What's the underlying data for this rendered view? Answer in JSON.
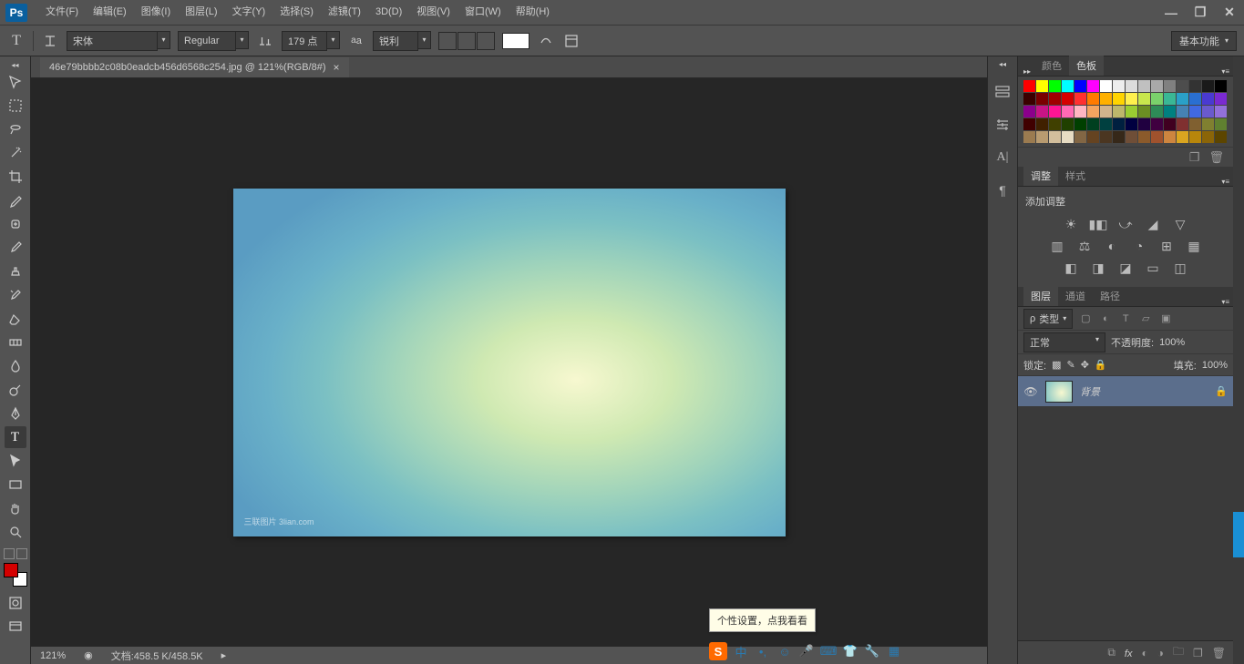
{
  "menubar": {
    "items": [
      "文件(F)",
      "编辑(E)",
      "图像(I)",
      "图层(L)",
      "文字(Y)",
      "选择(S)",
      "滤镜(T)",
      "3D(D)",
      "视图(V)",
      "窗口(W)",
      "帮助(H)"
    ]
  },
  "optbar": {
    "font_family": "宋体",
    "font_style": "Regular",
    "font_size": "179 点",
    "antialias": "锐利",
    "workspace": "基本功能"
  },
  "document": {
    "tab_title": "46e79bbbb2c08b0eadcb456d6568c254.jpg @ 121%(RGB/8#)",
    "watermark": "三联图片  3lian.com"
  },
  "status": {
    "zoom": "121%",
    "doc_size": "文档:458.5 K/458.5K"
  },
  "panels": {
    "color_tabs": [
      "颜色",
      "色板"
    ],
    "adjust_tabs": [
      "调整",
      "样式"
    ],
    "adjust_title": "添加调整",
    "layers_tabs": [
      "图层",
      "通道",
      "路径"
    ],
    "layer_filter": "类型",
    "blend_mode": "正常",
    "opacity_label": "不透明度:",
    "opacity_value": "100%",
    "lock_label": "锁定:",
    "fill_label": "填充:",
    "fill_value": "100%",
    "layer_name": "背景"
  },
  "tooltip": "个性设置，点我看看",
  "ime_lang": "中",
  "swatch_colors": [
    "#ff0000",
    "#ffff00",
    "#00ff00",
    "#00ffff",
    "#0000ff",
    "#ff00ff",
    "#ffffff",
    "#ededed",
    "#dcdcdc",
    "#c0c0c0",
    "#a9a9a9",
    "#808080",
    "#4d4d4d",
    "#333333",
    "#1a1a1a",
    "#000000",
    "#3a0000",
    "#7a0000",
    "#a00000",
    "#d40000",
    "#ff3030",
    "#ff7a00",
    "#ffb000",
    "#ffd400",
    "#fff04d",
    "#c8e64d",
    "#7ad16b",
    "#3ab795",
    "#2aa0c8",
    "#2a6fd1",
    "#4a3ad1",
    "#7a2ad1",
    "#8b008b",
    "#c71585",
    "#ff1493",
    "#ff69b4",
    "#ffb6c1",
    "#f4a460",
    "#d2b48c",
    "#bdb76b",
    "#9acd32",
    "#6b8e23",
    "#2e8b57",
    "#008080",
    "#4682b4",
    "#4169e1",
    "#6a5acd",
    "#9370db",
    "#400000",
    "#402000",
    "#404000",
    "#204000",
    "#004000",
    "#004020",
    "#004040",
    "#002040",
    "#000040",
    "#200040",
    "#400040",
    "#400020",
    "#803030",
    "#806030",
    "#808030",
    "#608030",
    "#9b7b50",
    "#b89b70",
    "#d2be9c",
    "#e7dcc3",
    "#826644",
    "#654321",
    "#4b3621",
    "#362819",
    "#6f4e37",
    "#8b5a2b",
    "#a0522d",
    "#cd853f",
    "#daa520",
    "#b8860b",
    "#8b6508",
    "#5c4500"
  ]
}
